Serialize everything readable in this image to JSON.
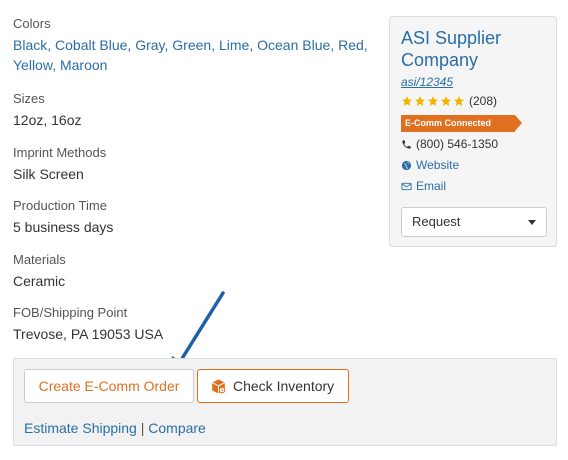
{
  "details": {
    "colors": {
      "label": "Colors",
      "items": [
        "Black",
        "Cobalt Blue",
        "Gray",
        "Green",
        "Lime",
        "Ocean Blue",
        "Red",
        "Yellow",
        "Maroon"
      ]
    },
    "sizes": {
      "label": "Sizes",
      "value": "12oz, 16oz"
    },
    "imprint": {
      "label": "Imprint Methods",
      "value": "Silk Screen"
    },
    "production": {
      "label": "Production Time",
      "value": "5 business days"
    },
    "materials": {
      "label": "Materials",
      "value": "Ceramic"
    },
    "fob": {
      "label": "FOB/Shipping Point",
      "value": "Trevose, PA 19053 USA"
    }
  },
  "supplier": {
    "name": "ASI Supplier Company",
    "asi_id": "asi/12345",
    "rating_stars": 5,
    "rating_count": "(208)",
    "badge": "E-Comm Connected",
    "phone": "(800) 546-1350",
    "website_label": "Website",
    "email_label": "Email",
    "request_label": "Request"
  },
  "actions": {
    "create_order_label": "Create E-Comm Order",
    "check_inventory_label": "Check Inventory",
    "estimate_shipping_label": "Estimate Shipping",
    "separator": "|",
    "compare_label": "Compare"
  },
  "colors_theme": {
    "link": "#2a6ea6",
    "accent": "#e07020",
    "star": "#f0b400",
    "arrow": "#1f5fa8"
  }
}
